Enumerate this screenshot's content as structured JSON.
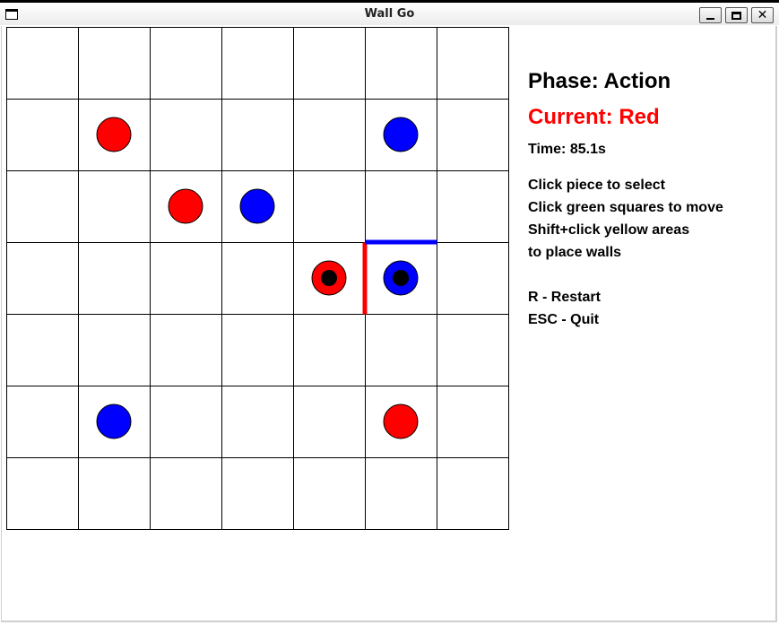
{
  "window": {
    "title": "Wall Go",
    "controls": [
      "minimize",
      "maximize",
      "close"
    ]
  },
  "board": {
    "rows": 7,
    "cols": 7,
    "pieces": [
      {
        "row": 1,
        "col": 1,
        "color": "red",
        "selected": false
      },
      {
        "row": 1,
        "col": 5,
        "color": "blue",
        "selected": false
      },
      {
        "row": 2,
        "col": 2,
        "color": "red",
        "selected": false
      },
      {
        "row": 2,
        "col": 3,
        "color": "blue",
        "selected": false
      },
      {
        "row": 3,
        "col": 4,
        "color": "red",
        "selected": true
      },
      {
        "row": 3,
        "col": 5,
        "color": "blue",
        "selected": true
      },
      {
        "row": 5,
        "col": 1,
        "color": "blue",
        "selected": false
      },
      {
        "row": 5,
        "col": 5,
        "color": "red",
        "selected": false
      }
    ],
    "walls": [
      {
        "type": "vertical",
        "row": 3,
        "between_cols": [
          4,
          5
        ],
        "color": "red"
      },
      {
        "type": "horizontal",
        "col": 5,
        "between_rows": [
          2,
          3
        ],
        "color": "blue"
      }
    ]
  },
  "colors": {
    "red": "#ff0000",
    "blue": "#0000ff",
    "grid": "#000000",
    "marker": "#000000"
  },
  "panel": {
    "phase": "Phase: Action",
    "current": "Current: Red",
    "current_color": "#ff0000",
    "time": "Time: 85.1s",
    "instructions": [
      "Click piece to select",
      "Click green squares to move",
      "Shift+click yellow areas",
      "to place walls"
    ],
    "keys": [
      "R - Restart",
      "ESC - Quit"
    ]
  }
}
